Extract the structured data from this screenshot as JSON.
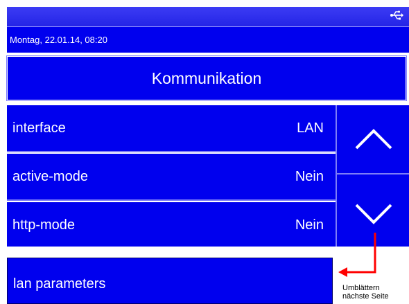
{
  "header": {
    "datetime": "Montag, 22.01.14, 08:20",
    "status_icon": "usb-icon"
  },
  "title": "Kommunikation",
  "rows": [
    {
      "label": "interface",
      "value": "LAN"
    },
    {
      "label": "active-mode",
      "value": "Nein"
    },
    {
      "label": "http-mode",
      "value": "Nein"
    }
  ],
  "lan_button": "lan parameters",
  "annotation": {
    "line1": "Umblättern",
    "line2": "nächste Seite"
  },
  "colors": {
    "panel_blue": "#0000ee",
    "divider": "#7e7ef6",
    "annotation_arrow": "#ff0000"
  }
}
